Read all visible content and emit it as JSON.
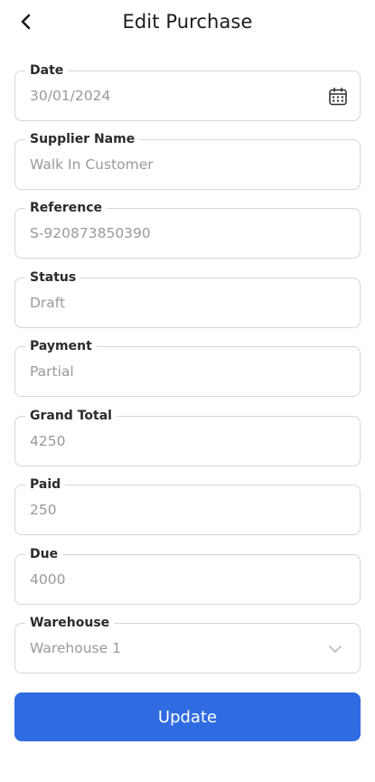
{
  "header": {
    "title": "Edit Purchase",
    "back_icon": "chevron-left-icon"
  },
  "form": {
    "fields": [
      {
        "label": "Date",
        "value": "30/01/2024",
        "icon": "calendar-icon"
      },
      {
        "label": "Supplier Name",
        "value": "Walk In Customer"
      },
      {
        "label": "Reference",
        "value": "S-920873850390"
      },
      {
        "label": "Status",
        "value": "Draft"
      },
      {
        "label": "Payment",
        "value": "Partial"
      },
      {
        "label": "Grand Total",
        "value": "4250"
      },
      {
        "label": "Paid",
        "value": "250"
      },
      {
        "label": "Due",
        "value": "4000"
      },
      {
        "label": "Warehouse",
        "value": "Warehouse 1",
        "icon": "chevron-down-icon"
      }
    ],
    "submit_label": "Update"
  },
  "colors": {
    "primary": "#2f6be1",
    "border": "#d6d6d6",
    "label": "#2b2b2b",
    "value": "#9a9a9a"
  }
}
